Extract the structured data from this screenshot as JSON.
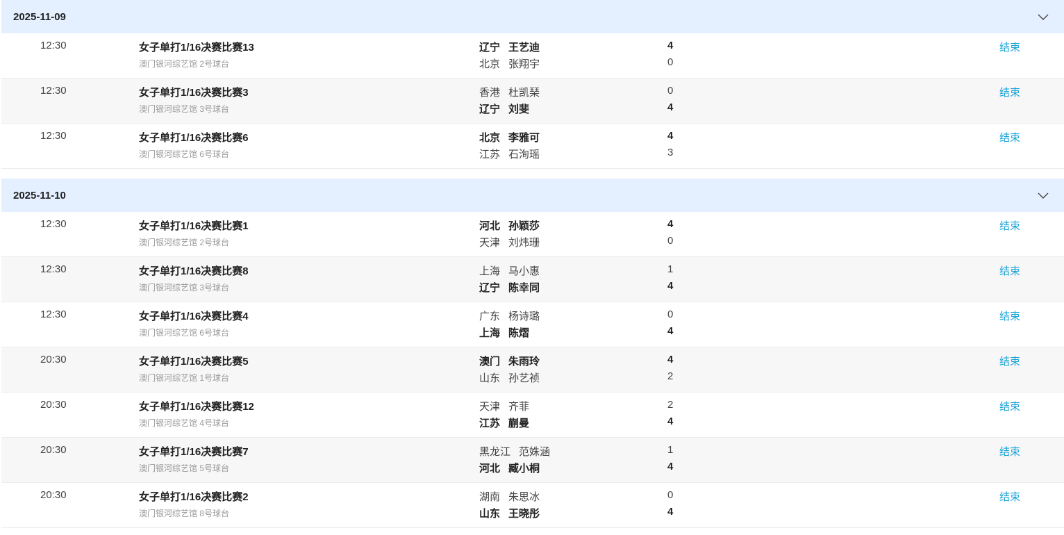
{
  "accent_color": "#1aa3d6",
  "header_bg": "#e4efff",
  "groups": [
    {
      "date": "2025-11-09",
      "matches": [
        {
          "time": "12:30",
          "name": "女子单打1/16决赛比赛13",
          "venue": "澳门银河综艺馆 2号球台",
          "p1": {
            "prov": "辽宁",
            "player": "王艺迪",
            "score": "4",
            "winner": true
          },
          "p2": {
            "prov": "北京",
            "player": "张翔宇",
            "score": "0",
            "winner": false
          },
          "status": "结束"
        },
        {
          "time": "12:30",
          "name": "女子单打1/16决赛比赛3",
          "venue": "澳门银河综艺馆 3号球台",
          "p1": {
            "prov": "香港",
            "player": "杜凯琹",
            "score": "0",
            "winner": false
          },
          "p2": {
            "prov": "辽宁",
            "player": "刘斐",
            "score": "4",
            "winner": true
          },
          "status": "结束"
        },
        {
          "time": "12:30",
          "name": "女子单打1/16决赛比赛6",
          "venue": "澳门银河综艺馆 6号球台",
          "p1": {
            "prov": "北京",
            "player": "李雅可",
            "score": "4",
            "winner": true
          },
          "p2": {
            "prov": "江苏",
            "player": "石洵瑶",
            "score": "3",
            "winner": false
          },
          "status": "结束"
        }
      ]
    },
    {
      "date": "2025-11-10",
      "matches": [
        {
          "time": "12:30",
          "name": "女子单打1/16决赛比赛1",
          "venue": "澳门银河综艺馆 2号球台",
          "p1": {
            "prov": "河北",
            "player": "孙颖莎",
            "score": "4",
            "winner": true
          },
          "p2": {
            "prov": "天津",
            "player": "刘炜珊",
            "score": "0",
            "winner": false
          },
          "status": "结束"
        },
        {
          "time": "12:30",
          "name": "女子单打1/16决赛比赛8",
          "venue": "澳门银河综艺馆 3号球台",
          "p1": {
            "prov": "上海",
            "player": "马小惠",
            "score": "1",
            "winner": false
          },
          "p2": {
            "prov": "辽宁",
            "player": "陈幸同",
            "score": "4",
            "winner": true
          },
          "status": "结束"
        },
        {
          "time": "12:30",
          "name": "女子单打1/16决赛比赛4",
          "venue": "澳门银河综艺馆 6号球台",
          "p1": {
            "prov": "广东",
            "player": "杨诗璐",
            "score": "0",
            "winner": false
          },
          "p2": {
            "prov": "上海",
            "player": "陈熠",
            "score": "4",
            "winner": true
          },
          "status": "结束"
        },
        {
          "time": "20:30",
          "name": "女子单打1/16决赛比赛5",
          "venue": "澳门银河综艺馆 1号球台",
          "p1": {
            "prov": "澳门",
            "player": "朱雨玲",
            "score": "4",
            "winner": true
          },
          "p2": {
            "prov": "山东",
            "player": "孙艺祯",
            "score": "2",
            "winner": false
          },
          "status": "结束"
        },
        {
          "time": "20:30",
          "name": "女子单打1/16决赛比赛12",
          "venue": "澳门银河综艺馆 4号球台",
          "p1": {
            "prov": "天津",
            "player": "齐菲",
            "score": "2",
            "winner": false
          },
          "p2": {
            "prov": "江苏",
            "player": "蒯曼",
            "score": "4",
            "winner": true
          },
          "status": "结束"
        },
        {
          "time": "20:30",
          "name": "女子单打1/16决赛比赛7",
          "venue": "澳门银河综艺馆 5号球台",
          "p1": {
            "prov": "黑龙江",
            "player": "范姝涵",
            "score": "1",
            "winner": false
          },
          "p2": {
            "prov": "河北",
            "player": "臧小桐",
            "score": "4",
            "winner": true
          },
          "status": "结束"
        },
        {
          "time": "20:30",
          "name": "女子单打1/16决赛比赛2",
          "venue": "澳门银河综艺馆 8号球台",
          "p1": {
            "prov": "湖南",
            "player": "朱思冰",
            "score": "0",
            "winner": false
          },
          "p2": {
            "prov": "山东",
            "player": "王晓彤",
            "score": "4",
            "winner": true
          },
          "status": "结束"
        }
      ]
    }
  ]
}
